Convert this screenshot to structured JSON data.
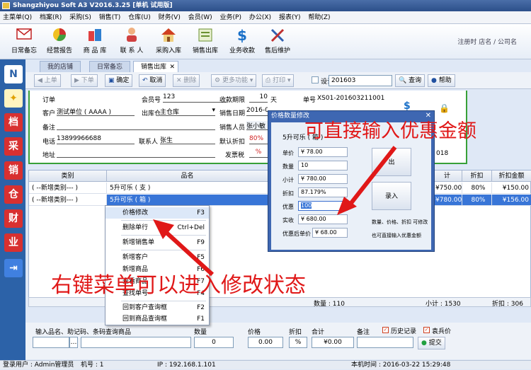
{
  "window": {
    "title": "Shangzhiyou Soft A3 V2016.3.25 [单机 试用版]"
  },
  "menubar": [
    "主菜单(Q)",
    "档案(R)",
    "采购(S)",
    "销售(T)",
    "仓库(U)",
    "财务(V)",
    "会员(W)",
    "业务(P)",
    "办公(X)",
    "报表(Y)",
    "帮助(Z)"
  ],
  "toolbar": [
    {
      "label": "日常备忘",
      "icon": "mail-icon"
    },
    {
      "label": "经营报告",
      "icon": "pie-chart-icon"
    },
    {
      "label": "商 品 库",
      "icon": "goods-icon"
    },
    {
      "label": "联 系 人",
      "icon": "person-icon"
    },
    {
      "label": "采购入库",
      "icon": "house-icon"
    },
    {
      "label": "销售出库",
      "icon": "sales-icon"
    },
    {
      "label": "业务收款",
      "icon": "dollar-icon"
    },
    {
      "label": "售后维护",
      "icon": "tools-icon"
    }
  ],
  "register_link": "注册时 店名 / 公司名",
  "sidebar": [
    "档",
    "采",
    "销",
    "仓",
    "财",
    "业"
  ],
  "tabs": [
    "我的店铺",
    "日常备忘",
    "销售出库"
  ],
  "worktoolbar": {
    "up": "上单",
    "down": "下单",
    "confirm": "确定",
    "cancel": "取消",
    "delete": "删除",
    "more": "更多功能",
    "print": "打印",
    "design": "设计",
    "period": "201603",
    "query": "查询",
    "help": "帮助"
  },
  "form": {
    "order_label": "订单",
    "member_label": "会员号",
    "member_value": "123",
    "terms_label": "收款期限",
    "terms_value": "10",
    "terms_unit": "天",
    "docno_label": "单号",
    "docno_value": "XS01-201603211001",
    "customer_label": "客户",
    "customer_value": "测试单位 ( AAAA )",
    "warehouse_label": "出库仓",
    "warehouse_value": "主仓库",
    "date_label": "销售日期",
    "date_value": "2016-03",
    "remark_label": "备注",
    "salesman_label": "销售人员",
    "salesman_value": "张小敏",
    "phone_label": "电话",
    "phone_value": "13899966688",
    "contact_label": "联系人",
    "contact_value": "张生",
    "discount_label": "默认折扣",
    "discount_value": "80%",
    "address_label": "地址",
    "tax_label": "发票税",
    "tax_value": "%",
    "year_tail": "018"
  },
  "grid": {
    "headers": [
      "类别",
      "品名",
      "计",
      "折扣",
      "折扣金额"
    ],
    "rows": [
      {
        "category": "( --新增类别--- )",
        "name": "5升可乐 ( 支 )",
        "total": "¥750.00",
        "discount": "80%",
        "amount": "¥150.00"
      },
      {
        "category": "( --新增类别--- )",
        "name": "5升可乐 ( 箱 )",
        "total": "¥780.00",
        "discount": "80%",
        "amount": "¥156.00"
      }
    ],
    "sum_qty": "数量 : 110",
    "sum_sub": "小计 : 1530",
    "sum_disc": "折扣 : 306"
  },
  "context_menu": [
    {
      "label": "价格修改",
      "shortcut": "F3"
    },
    {
      "label": "删除单行",
      "shortcut": "Ctrl+Del"
    },
    {
      "label": "新增销售单",
      "shortcut": "F9"
    },
    {
      "label": "新增客户",
      "shortcut": "F5"
    },
    {
      "label": "新增商品",
      "shortcut": "F6"
    },
    {
      "label": "查看商品",
      "shortcut": "F7"
    },
    {
      "label": "查找单号",
      "shortcut": "F4"
    },
    {
      "label": "回到客户查询框",
      "shortcut": "F2"
    },
    {
      "label": "回到商品查询框",
      "shortcut": "F1"
    }
  ],
  "dialog": {
    "title": "价格数量修改",
    "product": "5升可乐 ( 箱 )",
    "unit_price_label": "单价",
    "unit_price": "¥ 78.00",
    "qty_label": "数量",
    "qty": "10",
    "subtotal_label": "小计",
    "subtotal": "¥ 780.00",
    "discount_label": "折扣",
    "discount": "87.179%",
    "promo_label": "优惠",
    "promo": "100",
    "actual_label": "实收",
    "actual": "¥ 680.00",
    "after_label": "优惠后单价",
    "after": "¥ 68.00",
    "btn_out": "出",
    "btn_in": "录入",
    "hint1": "数量、价格、折扣 可修改",
    "hint2": "也可直接输入优惠金额"
  },
  "entry": {
    "search_label": "输入品名、助记码、条码查询商品",
    "qty_label": "数量",
    "qty": "0",
    "price_label": "价格",
    "price": "0.00",
    "disc_label": "折扣",
    "disc": "%",
    "total_label": "合计",
    "total": "¥0.00",
    "remark_label": "备注",
    "history": "历史记录",
    "reprice": "袁兵价",
    "submit": "提交"
  },
  "status": {
    "user": "登录用户 : Admin管理员",
    "machine": "机号 : 1",
    "ip": "IP : 192.168.1.101",
    "time": "本机时间 : 2016-03-22 15:29:48"
  },
  "annotations": {
    "top": "可直接输入优惠金额",
    "bottom": "右键菜单可以进入修改状态"
  },
  "colors": {
    "annotation": "#e01818",
    "selection": "#3875d7",
    "frame": "#38a038",
    "dialog": "#3e67b2"
  }
}
